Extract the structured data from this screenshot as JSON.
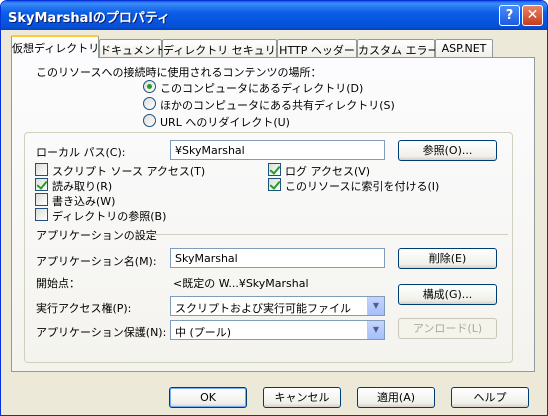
{
  "window": {
    "title": "SkyMarshalのプロパティ",
    "help_glyph": "?",
    "close_glyph": "✕"
  },
  "tabs": [
    {
      "label": "仮想ディレクトリ",
      "active": true
    },
    {
      "label": "ドキュメント"
    },
    {
      "label": "ディレクトリ セキュリティ"
    },
    {
      "label": "HTTP ヘッダー"
    },
    {
      "label": "カスタム エラー"
    },
    {
      "label": "ASP.NET"
    }
  ],
  "source": {
    "heading": "このリソースへの接続時に使用されるコンテンツの場所：",
    "options": [
      {
        "label": "このコンピュータにあるディレクトリ(D)",
        "selected": true
      },
      {
        "label": "ほかのコンピュータにある共有ディレクトリ(S)",
        "selected": false
      },
      {
        "label": "URL へのリダイレクト(U)",
        "selected": false
      }
    ]
  },
  "local_path": {
    "label": "ローカル パス(C):",
    "value": "¥SkyMarshal",
    "browse_button": "参照(O)..."
  },
  "permissions": {
    "script_source": {
      "label": "スクリプト ソース アクセス(T)",
      "checked": false
    },
    "read": {
      "label": "読み取り(R)",
      "checked": true
    },
    "write": {
      "label": "書き込み(W)",
      "checked": false
    },
    "dir_browse": {
      "label": "ディレクトリの参照(B)",
      "checked": false
    },
    "log_access": {
      "label": "ログ アクセス(V)",
      "checked": true
    },
    "index": {
      "label": "このリソースに索引を付ける(I)",
      "checked": true
    }
  },
  "app_settings": {
    "heading": "アプリケーションの設定",
    "name_label": "アプリケーション名(M):",
    "name_value": "SkyMarshal",
    "remove_button": "削除(E)",
    "start_label": "開始点：",
    "start_value": "<既定の W...¥SkyMarshal",
    "config_button": "構成(G)...",
    "exec_label": "実行アクセス権(P):",
    "exec_value": "スクリプトおよび実行可能ファイル",
    "protect_label": "アプリケーション保護(N):",
    "protect_value": "中 (プール)",
    "unload_button": "アンロード(L)"
  },
  "footer": {
    "ok": "OK",
    "cancel": "キャンセル",
    "apply": "適用(A)",
    "help": "ヘルプ"
  },
  "colors": {
    "titlebar": "#0a5de8",
    "window_face": "#ece9d8",
    "check_mark": "#21a121"
  }
}
